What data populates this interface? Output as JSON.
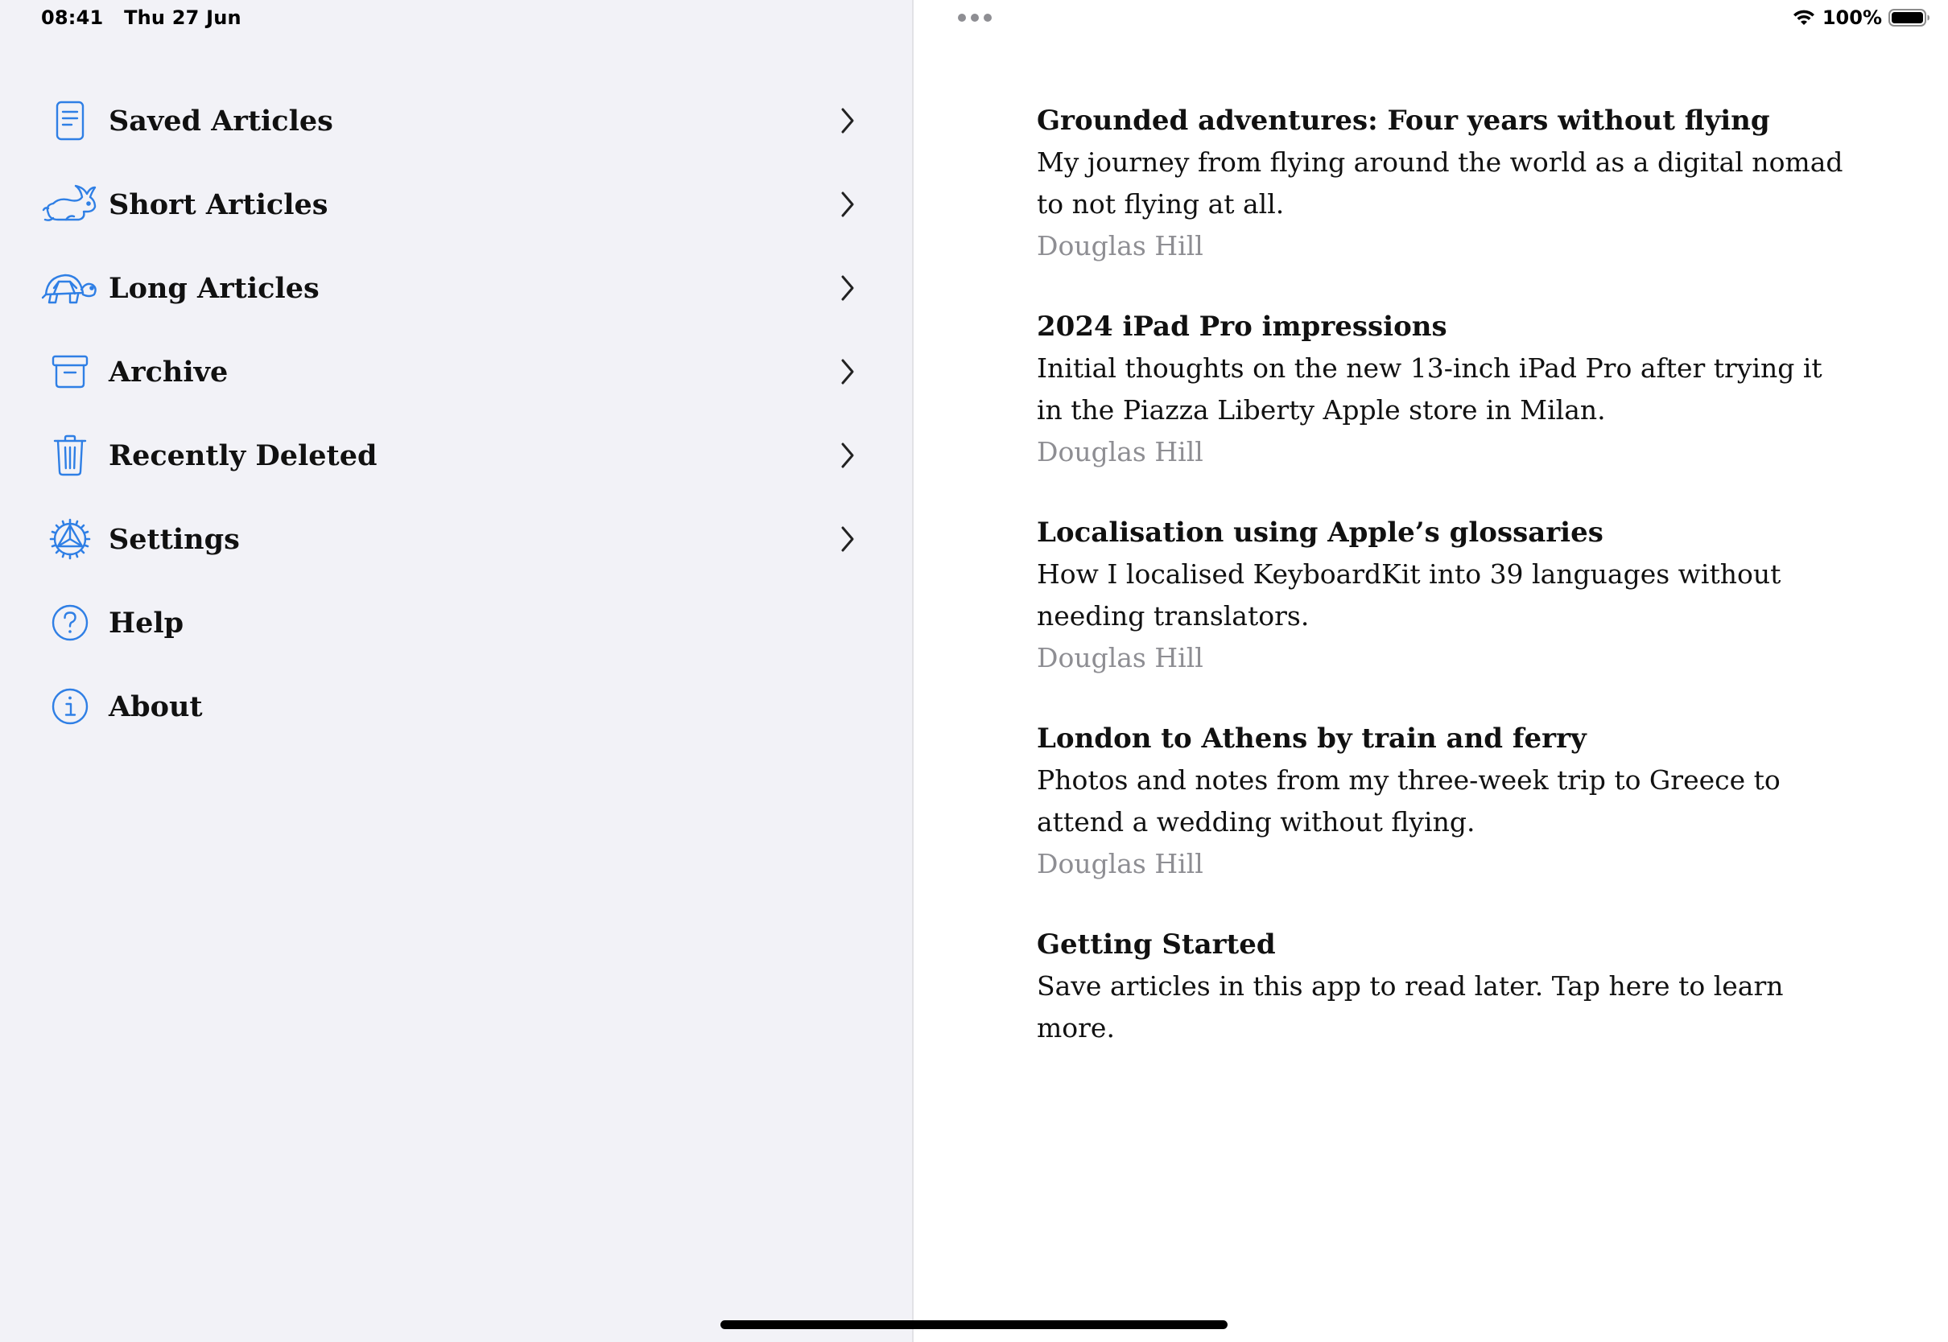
{
  "status_bar": {
    "time": "08:41",
    "date": "Thu 27 Jun",
    "battery": "100%",
    "wifi_icon": "wifi-icon",
    "battery_icon": "battery-icon"
  },
  "colors": {
    "accent": "#2f7fe5",
    "sidebar_background": "#f2f2f7",
    "author_gray": "#8e8e93"
  },
  "sidebar": {
    "items": [
      {
        "label": "Saved Articles",
        "icon": "document-icon",
        "has_chevron": true
      },
      {
        "label": "Short Articles",
        "icon": "rabbit-icon",
        "has_chevron": true
      },
      {
        "label": "Long Articles",
        "icon": "tortoise-icon",
        "has_chevron": true
      },
      {
        "label": "Archive",
        "icon": "archive-box-icon",
        "has_chevron": true
      },
      {
        "label": "Recently Deleted",
        "icon": "trash-icon",
        "has_chevron": true
      },
      {
        "label": "Settings",
        "icon": "gear-icon",
        "has_chevron": true
      },
      {
        "label": "Help",
        "icon": "question-circle-icon",
        "has_chevron": false
      },
      {
        "label": "About",
        "icon": "info-circle-icon",
        "has_chevron": false
      }
    ]
  },
  "articles": [
    {
      "title": "Grounded adventures: Four years without flying",
      "summary": "My journey from flying around the world as a digital nomad to not flying at all.",
      "author": "Douglas Hill"
    },
    {
      "title": "2024 iPad Pro impressions",
      "summary": "Initial thoughts on the new 13-inch iPad Pro after trying it in the Piazza Liberty Apple store in Milan.",
      "author": "Douglas Hill"
    },
    {
      "title": "Localisation using Apple’s glossaries",
      "summary": "How I localised KeyboardKit into 39 languages without needing translators.",
      "author": "Douglas Hill"
    },
    {
      "title": "London to Athens by train and ferry",
      "summary": "Photos and notes from my three-week trip to Greece to attend a wedding without flying.",
      "author": "Douglas Hill"
    },
    {
      "title": "Getting Started",
      "summary": "Save articles in this app to read later. Tap here to learn more.",
      "author": ""
    }
  ]
}
